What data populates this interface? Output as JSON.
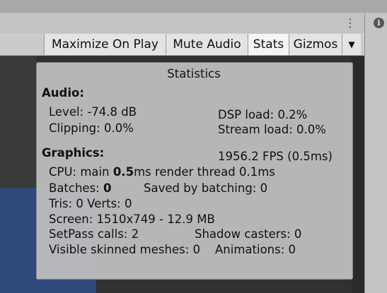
{
  "toolbar": {
    "maximize_label": "Maximize On Play",
    "mute_label": "Mute Audio",
    "stats_label": "Stats",
    "gizmos_label": "Gizmos",
    "gizmos_dropdown_glyph": "▼",
    "kebab_glyph": "⋮",
    "info_glyph": "i"
  },
  "stats": {
    "title": "Statistics",
    "audio_header": "Audio:",
    "level": "Level: -74.8 dB",
    "clipping": "Clipping: 0.0%",
    "dsp_load": "DSP load: 0.2%",
    "stream_load": "Stream load: 0.0%",
    "graphics_header": "Graphics:",
    "fps": "1956.2 FPS (0.5ms)",
    "cpu_prefix": "CPU: main ",
    "cpu_main_value": "0.5",
    "cpu_suffix": "ms  render thread 0.1ms",
    "batches_prefix": "Batches: ",
    "batches_value": "0",
    "saved_by_batching": "Saved by batching: 0",
    "tris_verts": "Tris: 0  Verts: 0",
    "screen": "Screen: 1510x749 - 12.9 MB",
    "setpass": "SetPass calls: 2",
    "shadow_casters": "Shadow casters: 0",
    "skinned_meshes": "Visible skinned meshes: 0",
    "animations": "Animations: 0"
  },
  "colors": {
    "toolbar_bg": "#cbcbcb",
    "button_bg": "#e4e4e4",
    "active_button_bg": "#f4f4f4",
    "stats_panel_bg": "#bebebe",
    "scene_dark": "#313131",
    "scene_blue": "#2e4a7c"
  }
}
